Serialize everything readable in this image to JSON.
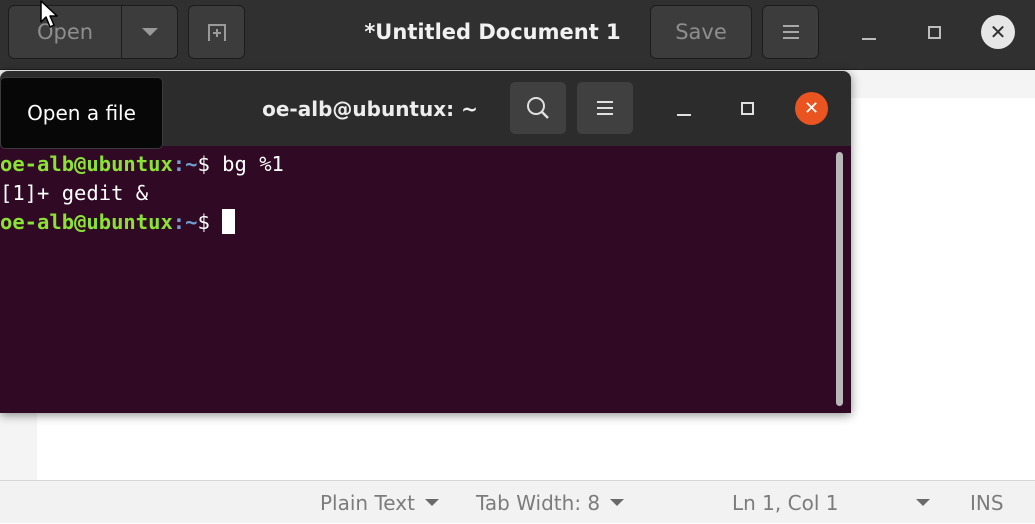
{
  "gedit": {
    "open_label": "Open",
    "new_tab_icon": "new-tab-icon",
    "title": "*Untitled Document 1",
    "save_label": "Save",
    "menu_icon": "hamburger-icon",
    "minimize_glyph": "—",
    "maximize_glyph": "☐",
    "close_glyph": "✕",
    "status": {
      "language": "Plain Text",
      "tab_width": "Tab Width: 8",
      "position": "Ln 1, Col 1",
      "mode": "INS"
    }
  },
  "tooltip": {
    "text": "Open a file"
  },
  "terminal": {
    "title": "oe-alb@ubuntux: ~",
    "close_glyph": "✕",
    "lines": [
      {
        "user": "oe-alb@ubuntux",
        "path": ":~",
        "prompt": "$ ",
        "command": "bg %1"
      },
      {
        "output": "[1]+ gedit &"
      },
      {
        "user": "oe-alb@ubuntux",
        "path": ":~",
        "prompt": "$ ",
        "command": ""
      }
    ]
  },
  "colors": {
    "terminal_bg": "#300a24",
    "prompt_user": "#8ae234",
    "prompt_path": "#729fcf",
    "close_accent": "#e95420"
  }
}
